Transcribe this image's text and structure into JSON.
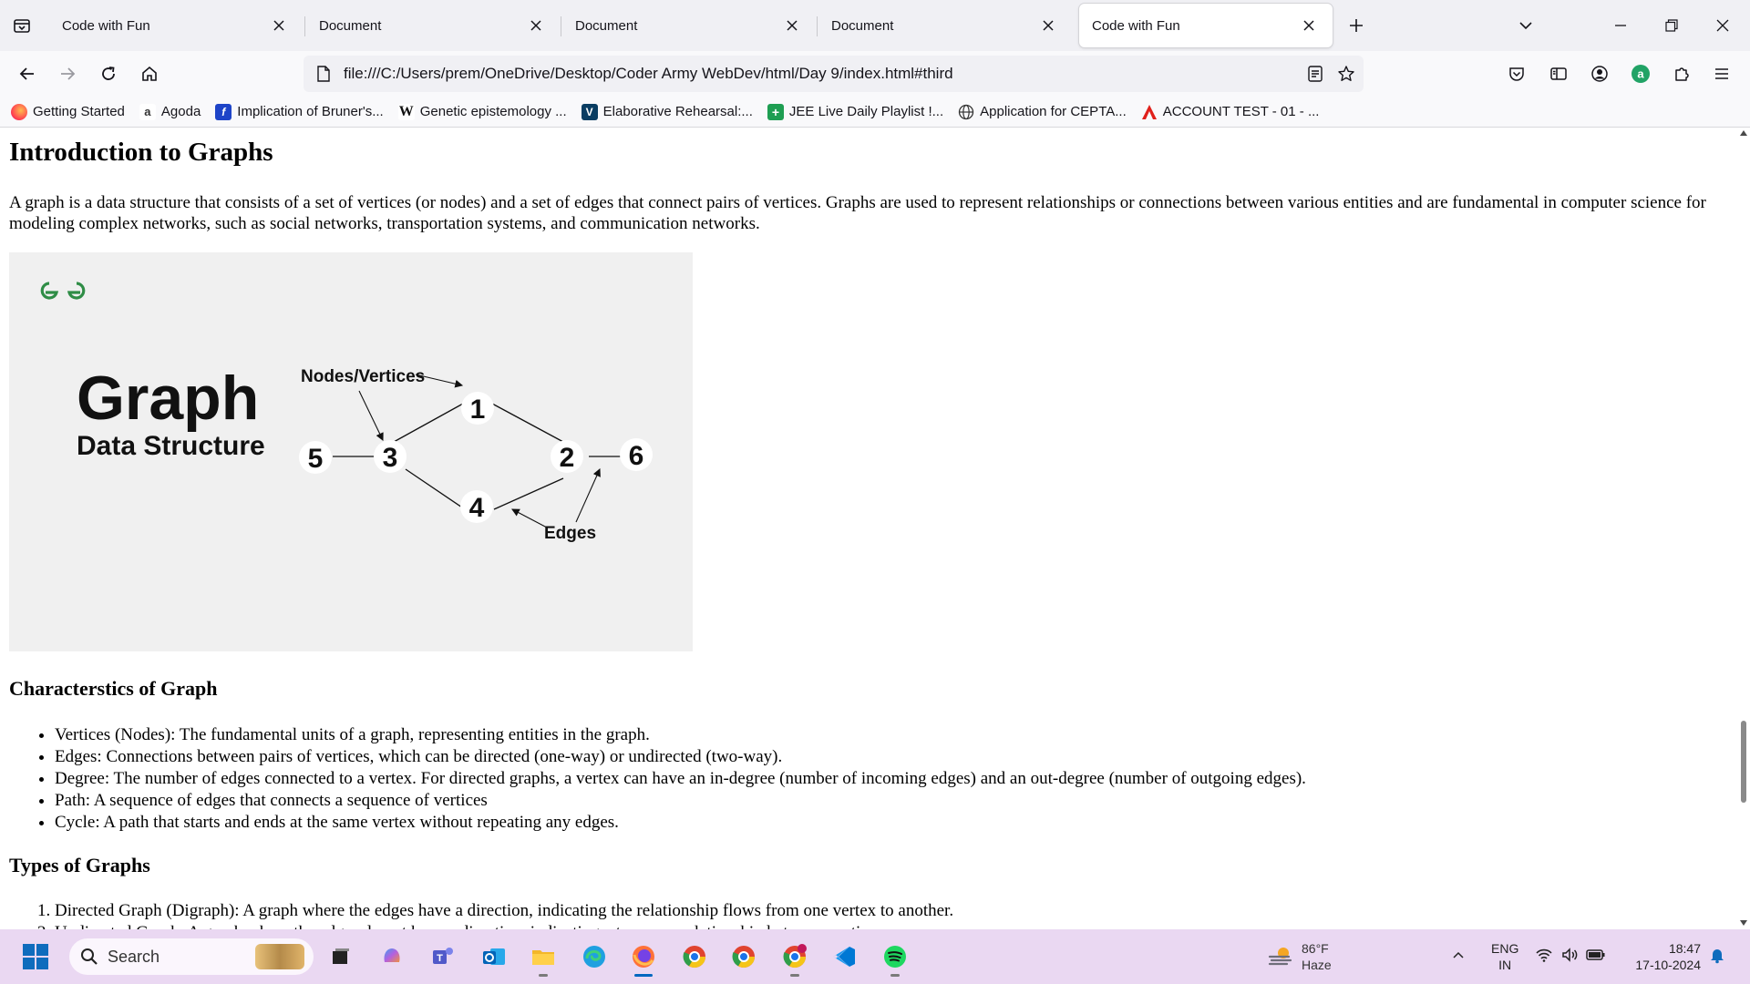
{
  "tabs": [
    {
      "title": "Code with Fun",
      "active": false
    },
    {
      "title": "Document",
      "active": false
    },
    {
      "title": "Document",
      "active": false
    },
    {
      "title": "Document",
      "active": false
    },
    {
      "title": "Code with Fun",
      "active": true
    }
  ],
  "navbar": {
    "url": "file:///C:/Users/prem/OneDrive/Desktop/Coder Army WebDev/html/Day 9/index.html#third"
  },
  "bookmarks": [
    {
      "label": "Getting Started",
      "icon": "firefox-icon"
    },
    {
      "label": "Agoda",
      "icon": "agoda-icon"
    },
    {
      "label": "Implication of Bruner's...",
      "icon": "jstor-icon"
    },
    {
      "label": "Genetic epistemology ...",
      "icon": "wikipedia-icon"
    },
    {
      "label": "Elaborative Rehearsal:...",
      "icon": "verywell-icon"
    },
    {
      "label": "JEE Live Daily Playlist !...",
      "icon": "sheets-icon"
    },
    {
      "label": "Application for CEPTA...",
      "icon": "globe-icon"
    },
    {
      "label": "ACCOUNT TEST - 01 - ...",
      "icon": "pdf-icon"
    }
  ],
  "content": {
    "heading": "Introduction to Graphs",
    "intro": "A graph is a data structure that consists of a set of vertices (or nodes) and a set of edges that connect pairs of vertices. Graphs are used to represent relationships or connections between various entities and are fundamental in computer science for modeling complex networks, such as social networks, transportation systems, and communication networks.",
    "figure": {
      "logo": "GfG",
      "title": "Graph",
      "subtitle": "Data Structure",
      "label_nodes": "Nodes/Vertices",
      "label_edges": "Edges",
      "nodes": [
        "1",
        "2",
        "3",
        "4",
        "5",
        "6"
      ]
    },
    "char_heading": "Characterstics of Graph",
    "characteristics": [
      "Vertices (Nodes): The fundamental units of a graph, representing entities in the graph.",
      "Edges: Connections between pairs of vertices, which can be directed (one-way) or undirected (two-way).",
      "Degree: The number of edges connected to a vertex. For directed graphs, a vertex can have an in-degree (number of incoming edges) and an out-degree (number of outgoing edges).",
      "Path: A sequence of edges that connects a sequence of vertices",
      "Cycle: A path that starts and ends at the same vertex without repeating any edges."
    ],
    "types_heading": "Types of Graphs",
    "types": [
      "Directed Graph (Digraph): A graph where the edges have a direction, indicating the relationship flows from one vertex to another.",
      "Undirected Graph: A graph where the edges do not have a direction, indicating a two-way relationship between vertices."
    ]
  },
  "taskbar": {
    "search_label": "Search",
    "weather_temp": "86°F",
    "weather_cond": "Haze",
    "lang_1": "ENG",
    "lang_2": "IN",
    "time": "18:47",
    "date": "17-10-2024"
  }
}
